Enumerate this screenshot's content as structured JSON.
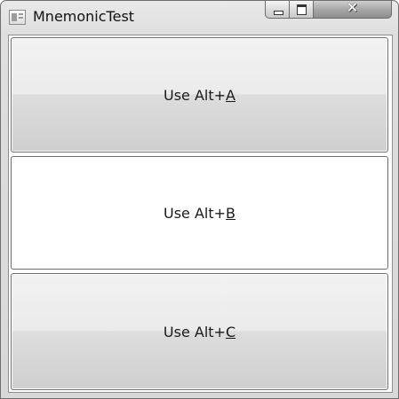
{
  "window": {
    "title": "MnemonicTest"
  },
  "buttons": [
    {
      "prefix": "Use Alt+",
      "access_key": "A"
    },
    {
      "prefix": "Use Alt+",
      "access_key": "B"
    },
    {
      "prefix": "Use Alt+",
      "access_key": "C"
    }
  ]
}
